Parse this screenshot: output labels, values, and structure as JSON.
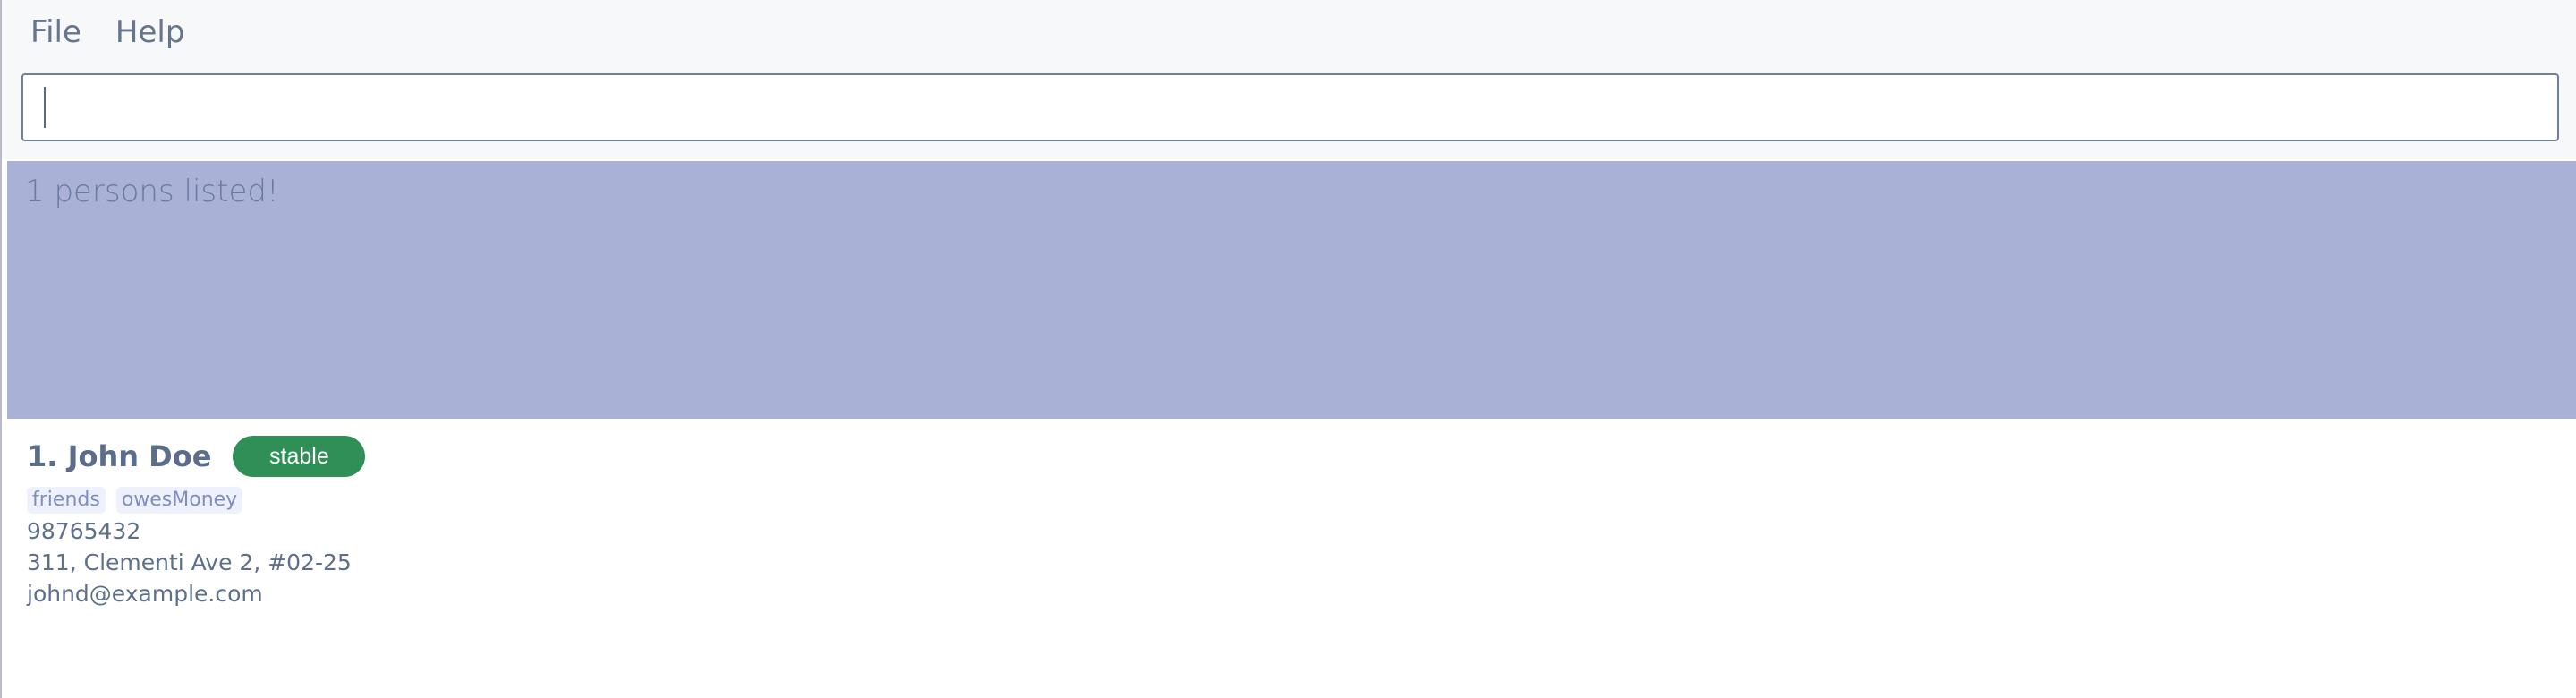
{
  "menu": {
    "file": "File",
    "help": "Help"
  },
  "command": {
    "value": "",
    "placeholder": ""
  },
  "result": {
    "message": "1 persons listed!"
  },
  "person": {
    "display_name": "1. John Doe",
    "status": "stable",
    "tags": [
      "friends",
      "owesMoney"
    ],
    "phone": "98765432",
    "address": "311, Clementi Ave 2, #02-25",
    "email": "johnd@example.com"
  },
  "colors": {
    "result_panel": "#aab1d7",
    "status_pill": "#2f8f56"
  }
}
